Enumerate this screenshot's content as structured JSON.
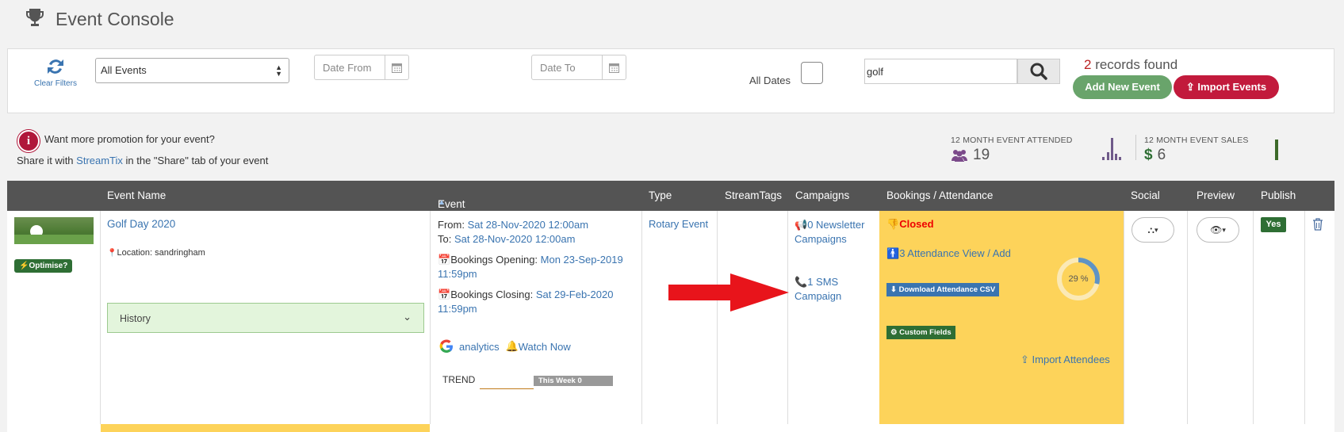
{
  "header": {
    "title": "Event Console",
    "icon": "trophy-icon"
  },
  "filters": {
    "clear_label": "Clear Filters",
    "event_select_value": "All Events",
    "date_from_placeholder": "Date From",
    "date_to_placeholder": "Date To",
    "all_dates_label": "All Dates",
    "search_value": "golf",
    "records_count": "2",
    "records_suffix": " records found",
    "add_label": "Add New Event",
    "import_label": "Import Events"
  },
  "promo": {
    "line1": "Want more promotion for your event?",
    "line2_pre": "Share it with ",
    "line2_link": "StreamTix",
    "line2_post": " in the \"Share\" tab of your event"
  },
  "stats": {
    "attended_label": "12 MONTH EVENT ATTENDED",
    "attended_value": "19",
    "sales_label": "12 MONTH EVENT SALES",
    "sales_currency": "$",
    "sales_value": "6"
  },
  "columns": [
    "Event Name",
    "Event Dates",
    "Type",
    "StreamTags",
    "Campaigns",
    "Bookings / Attendance",
    "Social",
    "Preview",
    "Publish"
  ],
  "row": {
    "optimise_label": "Optimise?",
    "event_name": "Golf Day 2020",
    "location": "Location: sandringham",
    "history_label": "History",
    "from_label": "From: ",
    "from_value": "Sat 28-Nov-2020 12:00am",
    "to_label": "To: ",
    "to_value": "Sat 28-Nov-2020 12:00am",
    "opening_label": "Bookings Opening: ",
    "opening_value_1": "Mon 23-Sep-2019",
    "opening_value_2": "11:59pm",
    "closing_label": "Bookings Closing: ",
    "closing_value_1": "Sat 29-Feb-2020",
    "closing_value_2": "11:59pm",
    "analytics_label": "analytics",
    "watch_label": "Watch Now",
    "trend_label": "TREND",
    "trend_badge": "This Week 0",
    "type": "Rotary Event",
    "newsletter_1": "0 Newsletter",
    "newsletter_2": "Campaigns",
    "sms_1": "1 SMS",
    "sms_2": "Campaign",
    "status": "Closed",
    "attendance_link": "3 Attendance View / Add",
    "download_csv": "Download Attendance CSV",
    "custom_fields": "Custom Fields",
    "import_attendees": "Import Attendees",
    "progress_label": "29 %",
    "progress_value": 0.29,
    "publish": "Yes"
  },
  "colors": {
    "accent_red": "#c21a3c",
    "accent_green": "#69a46b",
    "bookings_bg": "#fdd35a",
    "link": "#3a74b0",
    "arrow": "#e8141b"
  }
}
